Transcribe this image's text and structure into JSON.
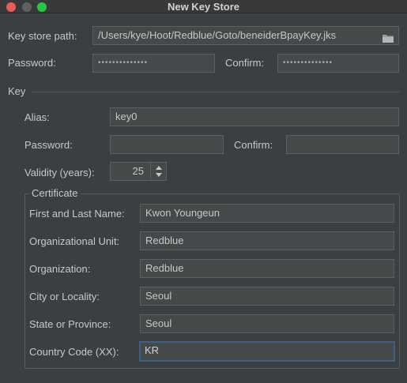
{
  "window": {
    "title": "New Key Store"
  },
  "keystore": {
    "path_label": "Key store path:",
    "path_value": "/Users/kye/Hoot/Redblue/Goto/beneiderBpayKey.jks",
    "password_label": "Password:",
    "password_value": "••••••••••••••",
    "confirm_label": "Confirm:",
    "confirm_value": "••••••••••••••"
  },
  "key": {
    "section_label": "Key",
    "alias_label": "Alias:",
    "alias_value": "key0",
    "password_label": "Password:",
    "password_value": "",
    "confirm_label": "Confirm:",
    "confirm_value": "",
    "validity_label": "Validity (years):",
    "validity_value": "25"
  },
  "certificate": {
    "group_label": "Certificate",
    "name_label": "First and Last Name:",
    "name_value": "Kwon Youngeun",
    "org_unit_label": "Organizational Unit:",
    "org_unit_value": "Redblue",
    "org_label": "Organization:",
    "org_value": "Redblue",
    "city_label": "City or Locality:",
    "city_value": "Seoul",
    "state_label": "State or Province:",
    "state_value": "Seoul",
    "country_label": "Country Code (XX):",
    "country_value": "KR"
  },
  "icons": {
    "browse": "folder-icon"
  },
  "colors": {
    "background": "#3c3f41",
    "field": "#45494a",
    "focus_border": "#3d6185"
  }
}
